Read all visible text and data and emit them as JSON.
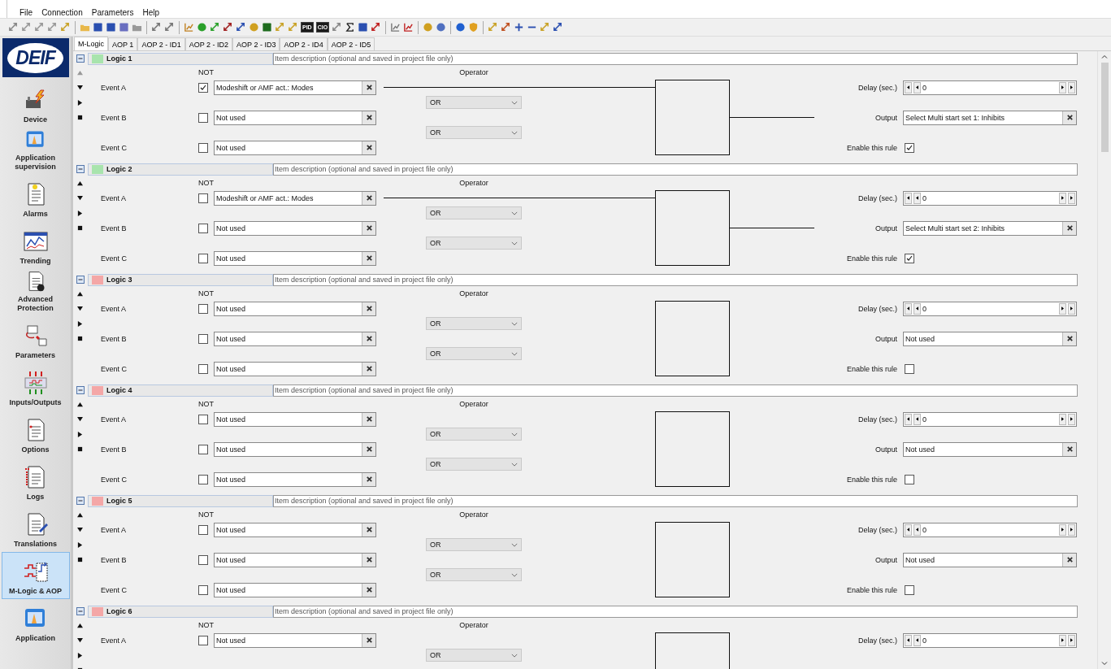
{
  "menu": [
    "File",
    "Connection",
    "Parameters",
    "Help"
  ],
  "toolbar": {
    "text_buttons": [
      "PID",
      "CIO"
    ]
  },
  "logo": "DEIF",
  "sidebar": {
    "items": [
      {
        "label": "Device",
        "selected": false
      },
      {
        "label": "Application supervision",
        "selected": false
      },
      {
        "label": "Alarms",
        "selected": false
      },
      {
        "label": "Trending",
        "selected": false
      },
      {
        "label": "Advanced Protection",
        "selected": false
      },
      {
        "label": "Parameters",
        "selected": false
      },
      {
        "label": "Inputs/Outputs",
        "selected": false
      },
      {
        "label": "Options",
        "selected": false
      },
      {
        "label": "Logs",
        "selected": false
      },
      {
        "label": "Translations",
        "selected": false
      },
      {
        "label": "M-Logic & AOP",
        "selected": true
      },
      {
        "label": "Application",
        "selected": false
      }
    ]
  },
  "tabs": [
    {
      "label": "M-Logic",
      "selected": true
    },
    {
      "label": "AOP 1",
      "selected": false
    },
    {
      "label": "AOP 2 - ID1",
      "selected": false
    },
    {
      "label": "AOP 2 - ID2",
      "selected": false
    },
    {
      "label": "AOP 2 - ID3",
      "selected": false
    },
    {
      "label": "AOP 2 - ID4",
      "selected": false
    },
    {
      "label": "AOP 2 - ID5",
      "selected": false
    }
  ],
  "logics": [
    {
      "title": "Logic 1",
      "color": "#a8e4ad",
      "move_up_enabled": false,
      "description_placeholder": "Item description (optional and saved in project file only)",
      "not_label": "NOT",
      "operator_label": "Operator",
      "events": [
        {
          "label": "Event A",
          "not": true,
          "value": "Modeshift or AMF act.: Modes",
          "connected": true
        },
        {
          "label": "Event B",
          "not": false,
          "value": "Not used",
          "connected": false
        },
        {
          "label": "Event C",
          "not": false,
          "value": "Not used",
          "connected": false
        }
      ],
      "operators": [
        "OR",
        "OR"
      ],
      "delay_label": "Delay (sec.)",
      "delay": "0",
      "output_label": "Output",
      "output": "Select Multi start set 1: Inhibits",
      "output_connected": true,
      "enable_label": "Enable this rule",
      "enabled": true
    },
    {
      "title": "Logic 2",
      "color": "#a8e4ad",
      "move_up_enabled": true,
      "description_placeholder": "Item description (optional and saved in project file only)",
      "not_label": "NOT",
      "operator_label": "Operator",
      "events": [
        {
          "label": "Event A",
          "not": false,
          "value": "Modeshift or AMF act.: Modes",
          "connected": true
        },
        {
          "label": "Event B",
          "not": false,
          "value": "Not used",
          "connected": false
        },
        {
          "label": "Event C",
          "not": false,
          "value": "Not used",
          "connected": false
        }
      ],
      "operators": [
        "OR",
        "OR"
      ],
      "delay_label": "Delay (sec.)",
      "delay": "0",
      "output_label": "Output",
      "output": "Select Multi start set 2: Inhibits",
      "output_connected": true,
      "enable_label": "Enable this rule",
      "enabled": true
    },
    {
      "title": "Logic 3",
      "color": "#f4a7a7",
      "move_up_enabled": true,
      "description_placeholder": "Item description (optional and saved in project file only)",
      "not_label": "NOT",
      "operator_label": "Operator",
      "events": [
        {
          "label": "Event A",
          "not": false,
          "value": "Not used",
          "connected": false
        },
        {
          "label": "Event B",
          "not": false,
          "value": "Not used",
          "connected": false
        },
        {
          "label": "Event C",
          "not": false,
          "value": "Not used",
          "connected": false
        }
      ],
      "operators": [
        "OR",
        "OR"
      ],
      "delay_label": "Delay (sec.)",
      "delay": "0",
      "output_label": "Output",
      "output": "Not used",
      "output_connected": false,
      "enable_label": "Enable this rule",
      "enabled": false
    },
    {
      "title": "Logic 4",
      "color": "#f4a7a7",
      "move_up_enabled": true,
      "description_placeholder": "Item description (optional and saved in project file only)",
      "not_label": "NOT",
      "operator_label": "Operator",
      "events": [
        {
          "label": "Event A",
          "not": false,
          "value": "Not used",
          "connected": false
        },
        {
          "label": "Event B",
          "not": false,
          "value": "Not used",
          "connected": false
        },
        {
          "label": "Event C",
          "not": false,
          "value": "Not used",
          "connected": false
        }
      ],
      "operators": [
        "OR",
        "OR"
      ],
      "delay_label": "Delay (sec.)",
      "delay": "0",
      "output_label": "Output",
      "output": "Not used",
      "output_connected": false,
      "enable_label": "Enable this rule",
      "enabled": false
    },
    {
      "title": "Logic 5",
      "color": "#f4a7a7",
      "move_up_enabled": true,
      "description_placeholder": "Item description (optional and saved in project file only)",
      "not_label": "NOT",
      "operator_label": "Operator",
      "events": [
        {
          "label": "Event A",
          "not": false,
          "value": "Not used",
          "connected": false
        },
        {
          "label": "Event B",
          "not": false,
          "value": "Not used",
          "connected": false
        },
        {
          "label": "Event C",
          "not": false,
          "value": "Not used",
          "connected": false
        }
      ],
      "operators": [
        "OR",
        "OR"
      ],
      "delay_label": "Delay (sec.)",
      "delay": "0",
      "output_label": "Output",
      "output": "Not used",
      "output_connected": false,
      "enable_label": "Enable this rule",
      "enabled": false
    },
    {
      "title": "Logic 6",
      "color": "#f4a7a7",
      "move_up_enabled": true,
      "description_placeholder": "Item description (optional and saved in project file only)",
      "not_label": "NOT",
      "operator_label": "Operator",
      "events": [
        {
          "label": "Event A",
          "not": false,
          "value": "Not used",
          "connected": false
        }
      ],
      "operators": [
        "OR"
      ],
      "delay_label": "Delay (sec.)",
      "delay": "0"
    }
  ]
}
